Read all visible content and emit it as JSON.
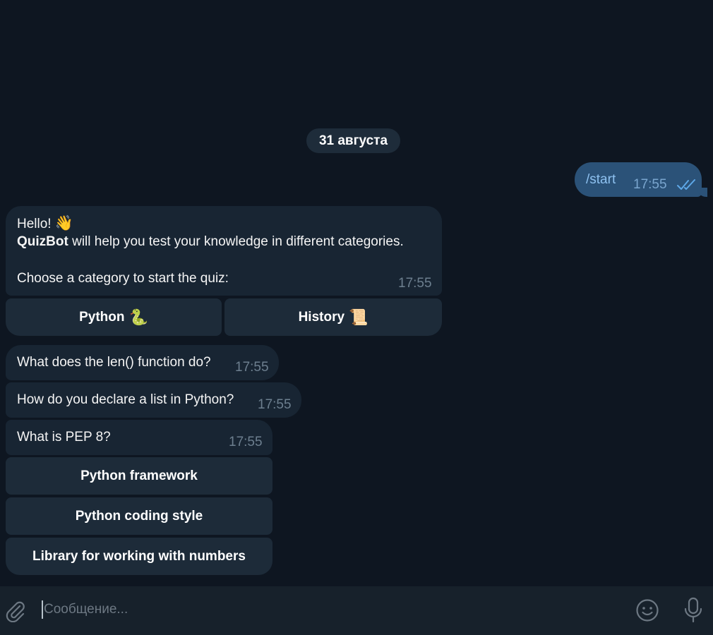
{
  "chat": {
    "date_separator": "31 августа",
    "outgoing": {
      "text": "/start",
      "time": "17:55",
      "status": "read"
    },
    "welcome": {
      "line1": "Hello!",
      "line1_emoji": "👋",
      "brand": "QuizBot",
      "line2_rest": " will help you test your knowledge in different categories.",
      "line3": "Choose a category to start the quiz:",
      "time": "17:55"
    },
    "category_buttons": [
      {
        "label": "Python",
        "emoji": "🐍"
      },
      {
        "label": "History",
        "emoji": "📜"
      }
    ],
    "questions": [
      {
        "text": "What does the len() function do?",
        "time": "17:55"
      },
      {
        "text": "How do you declare a list in Python?",
        "time": "17:55"
      },
      {
        "text": "What is PEP 8?",
        "time": "17:55"
      }
    ],
    "answer_buttons": [
      {
        "label": "Python framework"
      },
      {
        "label": "Python coding style"
      },
      {
        "label": "Library for working with numbers"
      }
    ]
  },
  "composer": {
    "placeholder": "Сообщение..."
  },
  "colors": {
    "background": "#0e1621",
    "incoming_bubble": "#182533",
    "outgoing_bubble": "#2b5278",
    "input_bar": "#17212b",
    "accent": "#5ea8e8"
  }
}
